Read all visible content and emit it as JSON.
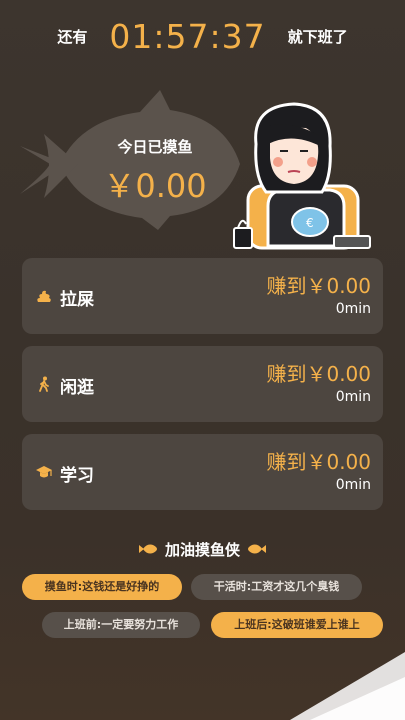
{
  "countdown": {
    "prefix": "还有",
    "time": "01:57:37",
    "suffix": "就下班了"
  },
  "today": {
    "label": "今日已摸鱼",
    "amount": "￥0.00"
  },
  "activities": [
    {
      "name": "拉屎",
      "icon": "poop-icon",
      "earned": "赚到￥0.00",
      "duration": "0min"
    },
    {
      "name": "闲逛",
      "icon": "walking-icon",
      "earned": "赚到￥0.00",
      "duration": "0min"
    },
    {
      "name": "学习",
      "icon": "graduation-cap-icon",
      "earned": "赚到￥0.00",
      "duration": "0min"
    }
  ],
  "motto": {
    "title": "加油摸鱼侠",
    "chips": [
      "摸鱼时:这钱还是好挣的",
      "干活时:工资才这几个臭钱",
      "上班前:一定要努力工作",
      "上班后:这破班谁爱上谁上"
    ]
  },
  "colors": {
    "accent": "#f4b14a",
    "card": "#4d4640",
    "background": "#3a322b"
  }
}
